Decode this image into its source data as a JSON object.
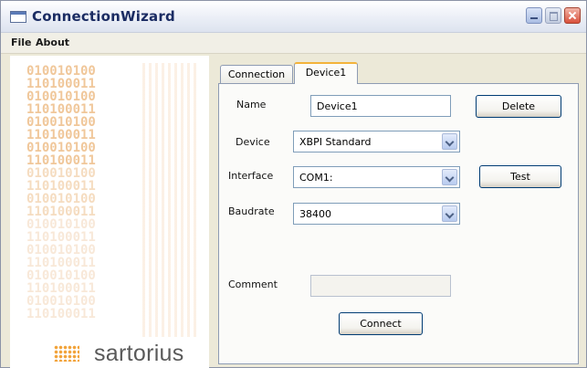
{
  "window": {
    "title": "ConnectionWizard"
  },
  "menu": {
    "items": [
      "File",
      "About"
    ]
  },
  "brand": {
    "binary_lines": [
      "010010100",
      "110100011",
      "010010100",
      "110100011",
      "010010100",
      "110100011",
      "010010100",
      "110100011",
      "010010100",
      "110100011",
      "010010100",
      "110100011",
      "010010100",
      "110100011",
      "010010100",
      "110100011",
      "010010100",
      "110100011",
      "010010100",
      "110100011"
    ],
    "logo_text": "sartorius",
    "accent_color": "#f2a33a"
  },
  "tabs": [
    {
      "label": "Connection",
      "active": false
    },
    {
      "label": "Device1",
      "active": true
    }
  ],
  "form": {
    "name": {
      "label": "Name",
      "value": "Device1"
    },
    "device": {
      "label": "Device",
      "value": "XBPI Standard"
    },
    "interface": {
      "label": "Interface",
      "value": "COM1:"
    },
    "baudrate": {
      "label": "Baudrate",
      "value": "38400"
    },
    "comment": {
      "label": "Comment",
      "value": ""
    }
  },
  "buttons": {
    "delete": "Delete",
    "test": "Test",
    "connect": "Connect"
  }
}
